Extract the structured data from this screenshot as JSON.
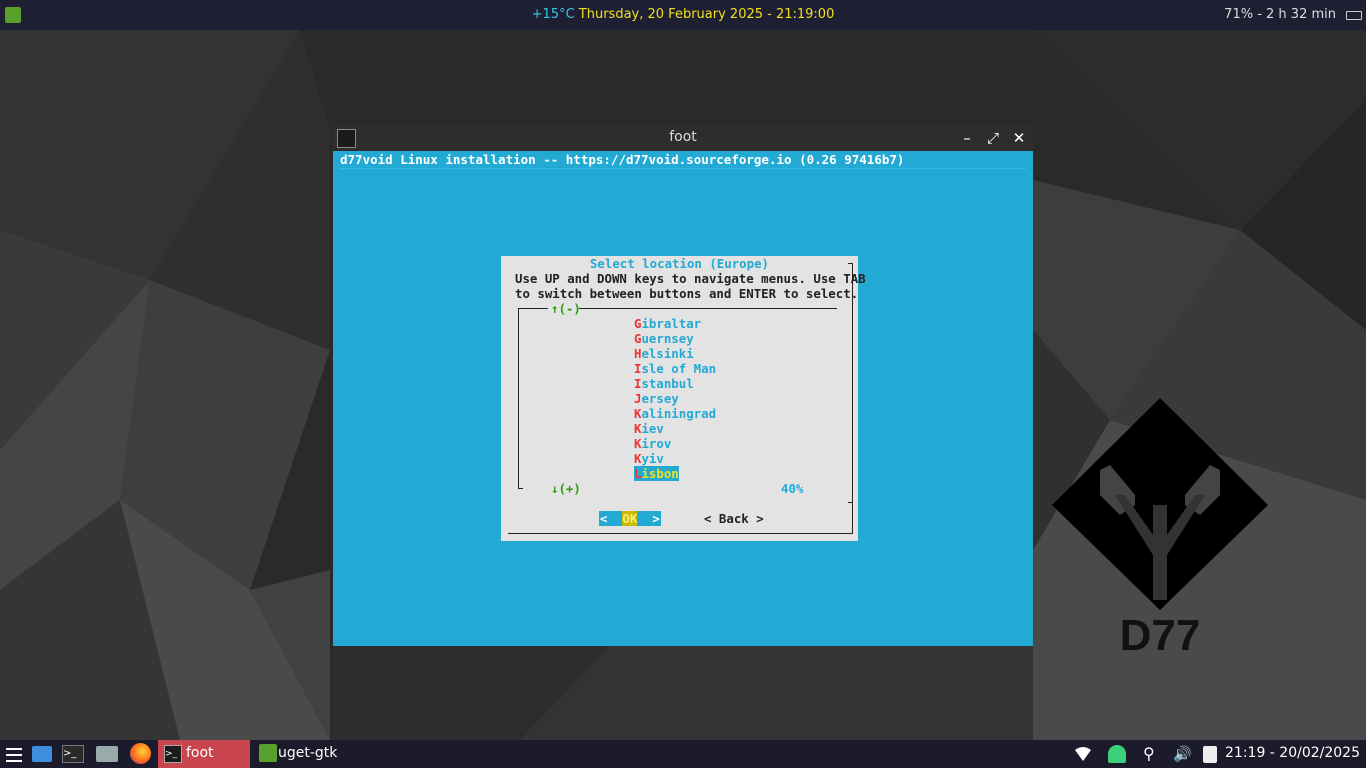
{
  "topbar": {
    "temperature": "+15°C",
    "datetime": "Thursday, 20 February 2025 - 21:19:00",
    "battery": "71% - 2 h 32 min"
  },
  "desktop": {
    "logo_text": "D77"
  },
  "window": {
    "title": "foot",
    "controls": {
      "minimize": "–",
      "maximize": "⤢",
      "close": "✕"
    },
    "header": "d77void Linux installation -- https://d77void.sourceforge.io (0.26 97416b7)"
  },
  "dialog": {
    "title": "Select location (Europe)",
    "instructions": "Use UP and DOWN keys to navigate menus. Use TAB\nto switch between buttons and ENTER to select.",
    "scroll_up": "↑(-)",
    "scroll_down": "↓(+)",
    "percent": "40%",
    "items": [
      {
        "hot": "G",
        "rest": "ibraltar"
      },
      {
        "hot": "G",
        "rest": "uernsey"
      },
      {
        "hot": "H",
        "rest": "elsinki"
      },
      {
        "hot": "I",
        "rest": "sle of Man"
      },
      {
        "hot": "I",
        "rest": "stanbul"
      },
      {
        "hot": "J",
        "rest": "ersey"
      },
      {
        "hot": "K",
        "rest": "aliningrad"
      },
      {
        "hot": "K",
        "rest": "iev"
      },
      {
        "hot": "K",
        "rest": "irov"
      },
      {
        "hot": "K",
        "rest": "yiv"
      },
      {
        "hot": "L",
        "rest": "isbon"
      }
    ],
    "selected_index": 10,
    "ok_left": "<  ",
    "ok_label": "OK",
    "ok_right": "  >",
    "back_button": "< Back >"
  },
  "taskbar": {
    "tasks": [
      {
        "label": "foot",
        "active": true
      },
      {
        "label": "uget-gtk",
        "active": false
      }
    ],
    "clock": "21:19 - 20/02/2025"
  },
  "colors": {
    "terminal_bg": "#22a9d4",
    "dialog_bg": "#e3e3e3",
    "highlight": "#f0e020",
    "hotkey": "#ee3333",
    "scroll": "#2e9a12",
    "active_task": "#c9454d"
  }
}
